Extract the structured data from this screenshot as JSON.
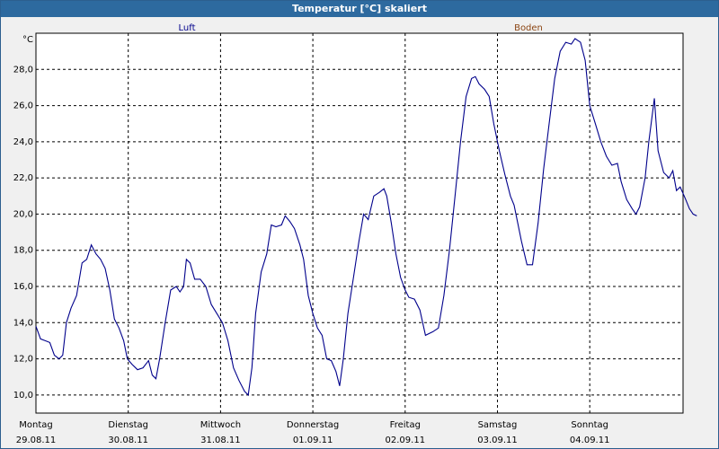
{
  "window_title": "Temperatur [°C] skaliert",
  "chart_data": {
    "type": "line",
    "title": "Temperatur [°C] skaliert",
    "ylabel": "°C",
    "ylim": [
      9.0,
      30.0
    ],
    "xlim": [
      0,
      7
    ],
    "y_ticks": [
      10.0,
      12.0,
      14.0,
      16.0,
      18.0,
      20.0,
      22.0,
      24.0,
      26.0,
      28.0
    ],
    "y_tick_labels": [
      "10,0",
      "12,0",
      "14,0",
      "16,0",
      "18,0",
      "20,0",
      "22,0",
      "24,0",
      "26,0",
      "28,0"
    ],
    "x_ticks": [
      {
        "day": "Montag",
        "date": "29.08.11"
      },
      {
        "day": "Dienstag",
        "date": "30.08.11"
      },
      {
        "day": "Mittwoch",
        "date": "31.08.11"
      },
      {
        "day": "Donnerstag",
        "date": "01.09.11"
      },
      {
        "day": "Freitag",
        "date": "02.09.11"
      },
      {
        "day": "Samstag",
        "date": "03.09.11"
      },
      {
        "day": "Sonntag",
        "date": "04.09.11"
      }
    ],
    "grid": true,
    "legend": [
      {
        "name": "Luft",
        "color": "#00008b"
      },
      {
        "name": "Boden",
        "color": "#8b4513"
      }
    ],
    "series": [
      {
        "name": "Luft",
        "color": "#00008b",
        "points": [
          [
            0.0,
            13.8
          ],
          [
            0.05,
            13.1
          ],
          [
            0.1,
            13.0
          ],
          [
            0.15,
            12.9
          ],
          [
            0.2,
            12.2
          ],
          [
            0.25,
            12.0
          ],
          [
            0.29,
            12.2
          ],
          [
            0.33,
            14.0
          ],
          [
            0.38,
            14.8
          ],
          [
            0.44,
            15.5
          ],
          [
            0.5,
            17.3
          ],
          [
            0.55,
            17.5
          ],
          [
            0.6,
            18.3
          ],
          [
            0.65,
            17.8
          ],
          [
            0.7,
            17.5
          ],
          [
            0.75,
            17.0
          ],
          [
            0.8,
            15.8
          ],
          [
            0.85,
            14.2
          ],
          [
            0.9,
            13.7
          ],
          [
            0.95,
            13.0
          ],
          [
            0.99,
            12.0
          ],
          [
            1.04,
            11.7
          ],
          [
            1.1,
            11.4
          ],
          [
            1.16,
            11.5
          ],
          [
            1.22,
            11.9
          ],
          [
            1.26,
            11.1
          ],
          [
            1.3,
            10.9
          ],
          [
            1.34,
            12.0
          ],
          [
            1.4,
            14.0
          ],
          [
            1.46,
            15.8
          ],
          [
            1.52,
            16.0
          ],
          [
            1.56,
            15.7
          ],
          [
            1.6,
            16.0
          ],
          [
            1.63,
            17.5
          ],
          [
            1.67,
            17.3
          ],
          [
            1.72,
            16.4
          ],
          [
            1.78,
            16.4
          ],
          [
            1.84,
            16.0
          ],
          [
            1.9,
            15.0
          ],
          [
            1.96,
            14.5
          ],
          [
            2.02,
            14.0
          ],
          [
            2.08,
            13.0
          ],
          [
            2.14,
            11.5
          ],
          [
            2.2,
            10.8
          ],
          [
            2.26,
            10.2
          ],
          [
            2.3,
            10.0
          ],
          [
            2.34,
            11.5
          ],
          [
            2.38,
            14.5
          ],
          [
            2.44,
            16.8
          ],
          [
            2.5,
            17.8
          ],
          [
            2.55,
            19.4
          ],
          [
            2.6,
            19.3
          ],
          [
            2.66,
            19.4
          ],
          [
            2.7,
            19.9
          ],
          [
            2.75,
            19.6
          ],
          [
            2.8,
            19.2
          ],
          [
            2.86,
            18.3
          ],
          [
            2.9,
            17.5
          ],
          [
            2.95,
            15.5
          ],
          [
            3.0,
            14.5
          ],
          [
            3.05,
            13.7
          ],
          [
            3.1,
            13.3
          ],
          [
            3.15,
            12.0
          ],
          [
            3.2,
            11.9
          ],
          [
            3.25,
            11.3
          ],
          [
            3.29,
            10.5
          ],
          [
            3.33,
            12.0
          ],
          [
            3.38,
            14.5
          ],
          [
            3.44,
            16.5
          ],
          [
            3.5,
            18.5
          ],
          [
            3.55,
            20.0
          ],
          [
            3.6,
            19.7
          ],
          [
            3.66,
            21.0
          ],
          [
            3.72,
            21.2
          ],
          [
            3.77,
            21.4
          ],
          [
            3.8,
            21.0
          ],
          [
            3.85,
            19.5
          ],
          [
            3.9,
            17.8
          ],
          [
            3.95,
            16.5
          ],
          [
            4.0,
            15.8
          ],
          [
            4.04,
            15.4
          ],
          [
            4.1,
            15.3
          ],
          [
            4.16,
            14.7
          ],
          [
            4.22,
            13.3
          ],
          [
            4.3,
            13.5
          ],
          [
            4.36,
            13.7
          ],
          [
            4.42,
            15.5
          ],
          [
            4.48,
            18.0
          ],
          [
            4.54,
            21.0
          ],
          [
            4.6,
            24.0
          ],
          [
            4.66,
            26.5
          ],
          [
            4.72,
            27.5
          ],
          [
            4.76,
            27.6
          ],
          [
            4.8,
            27.2
          ],
          [
            4.86,
            26.9
          ],
          [
            4.91,
            26.5
          ],
          [
            4.96,
            25.0
          ],
          [
            5.02,
            23.5
          ],
          [
            5.08,
            22.2
          ],
          [
            5.14,
            21.0
          ],
          [
            5.18,
            20.5
          ],
          [
            5.22,
            19.5
          ],
          [
            5.26,
            18.5
          ],
          [
            5.32,
            17.2
          ],
          [
            5.38,
            17.2
          ],
          [
            5.44,
            19.5
          ],
          [
            5.5,
            22.5
          ],
          [
            5.56,
            25.0
          ],
          [
            5.62,
            27.5
          ],
          [
            5.68,
            29.0
          ],
          [
            5.74,
            29.5
          ],
          [
            5.8,
            29.4
          ],
          [
            5.84,
            29.7
          ],
          [
            5.9,
            29.5
          ],
          [
            5.95,
            28.5
          ],
          [
            6.0,
            26.0
          ],
          [
            6.06,
            25.0
          ],
          [
            6.12,
            24.0
          ],
          [
            6.18,
            23.2
          ],
          [
            6.24,
            22.7
          ],
          [
            6.3,
            22.8
          ],
          [
            6.34,
            21.8
          ],
          [
            6.4,
            20.8
          ],
          [
            6.46,
            20.3
          ],
          [
            6.5,
            20.0
          ],
          [
            6.54,
            20.4
          ],
          [
            6.6,
            22.0
          ],
          [
            6.64,
            24.0
          ],
          [
            6.7,
            26.4
          ],
          [
            6.74,
            23.5
          ],
          [
            6.8,
            22.3
          ],
          [
            6.86,
            22.0
          ],
          [
            6.9,
            22.4
          ],
          [
            6.94,
            21.3
          ],
          [
            6.98,
            21.5
          ],
          [
            7.04,
            20.8
          ],
          [
            7.08,
            20.3
          ],
          [
            7.12,
            20.0
          ],
          [
            7.16,
            19.9
          ]
        ]
      }
    ]
  }
}
